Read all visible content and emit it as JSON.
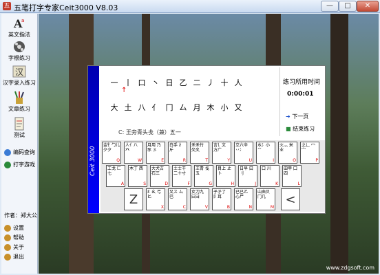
{
  "window": {
    "title": "五笔打字专家Ceit3000 V8.03",
    "app_icon": "五",
    "minimize_label": "—",
    "maximize_label": "□",
    "close_label": "✕"
  },
  "sidebar": {
    "items": [
      {
        "label": "英文指法",
        "icon": "letter-a-icon"
      },
      {
        "label": "字根练习",
        "icon": "film-reel-icon"
      },
      {
        "label": "汉字录入练习",
        "icon": "hanzi-icon"
      },
      {
        "label": "文章练习",
        "icon": "pen-cup-icon"
      },
      {
        "label": "测试",
        "icon": "exam-icon"
      },
      {
        "label": "编码查询",
        "icon": "search-icon"
      },
      {
        "label": "打字游戏",
        "icon": "game-icon"
      }
    ],
    "author": "作者：郑大公",
    "bottom": [
      {
        "label": "设置",
        "icon": "settings-icon"
      },
      {
        "label": "帮助",
        "icon": "help-icon"
      },
      {
        "label": "关于",
        "icon": "about-icon"
      },
      {
        "label": "退出",
        "icon": "exit-icon"
      }
    ]
  },
  "practice": {
    "row1": [
      "一",
      "丨",
      "口",
      "丶",
      "日",
      "乙",
      "二",
      "丿",
      "十",
      "人"
    ],
    "row2": [
      "大",
      "土",
      "八",
      "亻",
      "冂",
      "厶",
      "月",
      "木",
      "小",
      "又"
    ],
    "hint": "C: 王旁青头戋（兼）五一",
    "banner": "Ceit 3000"
  },
  "status": {
    "time_label": "练习所用时间",
    "time_value": "0:00:01",
    "next_label": "下一页",
    "end_label": "结束练习"
  },
  "keyboard": {
    "row1": [
      {
        "rad": "金钅勹儿 夕夕",
        "ltr": "Q"
      },
      {
        "rad": "人亻八 癶",
        "ltr": "W"
      },
      {
        "rad": "月用 乃豕 彡",
        "ltr": "E"
      },
      {
        "rad": "白手 扌斤",
        "ltr": "R"
      },
      {
        "rad": "禾禾竹 攵夂",
        "ltr": "T"
      },
      {
        "rad": "言讠文 方广",
        "ltr": "Y"
      },
      {
        "rad": "立六辛 丷冫",
        "ltr": "U"
      },
      {
        "rad": "水氵小 ⺌",
        "ltr": "I"
      },
      {
        "rad": "火灬 米业",
        "ltr": "O"
      },
      {
        "rad": "之辶 冖宀",
        "ltr": "P"
      }
    ],
    "row2": [
      {
        "rad": "工戈 匚七",
        "ltr": "A"
      },
      {
        "rad": "木丁 西",
        "ltr": "S"
      },
      {
        "rad": "大犬古 石三",
        "ltr": "D"
      },
      {
        "rad": "土士干 二十寸",
        "ltr": "F"
      },
      {
        "rad": "王青 戋五",
        "ltr": "G"
      },
      {
        "rad": "目上 止卜",
        "ltr": "H"
      },
      {
        "rad": "日早 曰刂",
        "ltr": "J"
      },
      {
        "rad": "口 川",
        "ltr": "K"
      },
      {
        "rad": "田甲 囗四",
        "ltr": "L"
      }
    ],
    "row3": [
      {
        "rad": "纟幺 弓匕",
        "ltr": "X"
      },
      {
        "rad": "又ス ム巴",
        "ltr": "C"
      },
      {
        "rad": "女刀九 臼彐",
        "ltr": "V"
      },
      {
        "rad": "子孑了 阝耳",
        "ltr": "B"
      },
      {
        "rad": "已巳乙 心尸",
        "ltr": "N"
      },
      {
        "rad": "山由贝 冂几",
        "ltr": "M"
      }
    ],
    "z_label": "Z",
    "slash_label": "<"
  },
  "watermark": "www.zdgsoft.com"
}
